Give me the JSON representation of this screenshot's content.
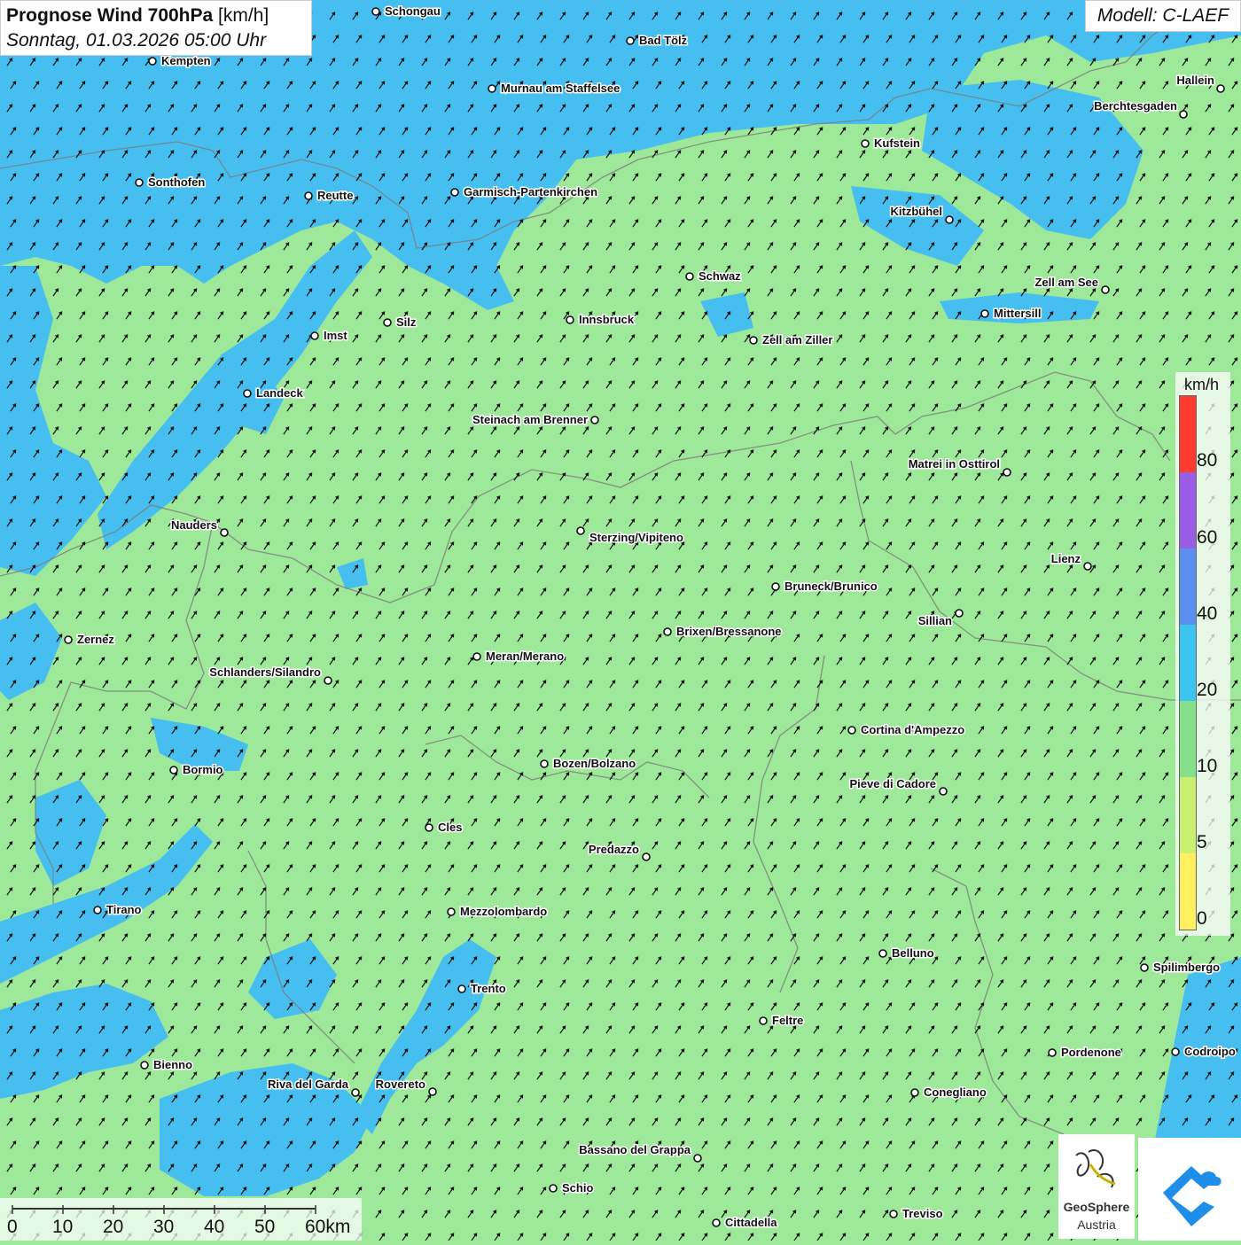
{
  "title": {
    "main": "Prognose Wind 700hPa",
    "unit": "[km/h]",
    "date": "Sonntag, 01.03.2026 05:00 Uhr"
  },
  "model": "Modell: C-LAEF",
  "legend": {
    "unit": "km/h",
    "labels": [
      "80",
      "60",
      "40",
      "20",
      "10",
      "5",
      "0"
    ],
    "colors": [
      "#ff3b30",
      "#9b5de5",
      "#5b8ff0",
      "#3cc4f0",
      "#86e08a",
      "#c9f06e",
      "#fff060"
    ]
  },
  "scale": {
    "labels": [
      "0",
      "10",
      "20",
      "30",
      "40",
      "50",
      "60km"
    ]
  },
  "branding": {
    "line1": "GeoSphere",
    "line2": "Austria"
  },
  "field_colors": {
    "green": "#9ee89a",
    "blue": "#46bff0"
  },
  "cities": [
    {
      "name": "Schongau"
    },
    {
      "name": "Bad Tölz"
    },
    {
      "name": "Kempten"
    },
    {
      "name": "Murnau am Staffelsee"
    },
    {
      "name": "Hallein"
    },
    {
      "name": "Berchtesgaden"
    },
    {
      "name": "Kufstein"
    },
    {
      "name": "Sonthofen"
    },
    {
      "name": "Reutte"
    },
    {
      "name": "Garmisch-Partenkirchen"
    },
    {
      "name": "Kitzbühel"
    },
    {
      "name": "Schwaz"
    },
    {
      "name": "Zell am See"
    },
    {
      "name": "Mittersill"
    },
    {
      "name": "Innsbruck"
    },
    {
      "name": "Silz"
    },
    {
      "name": "Imst"
    },
    {
      "name": "Zell am Ziller"
    },
    {
      "name": "Landeck"
    },
    {
      "name": "Steinach am Brenner"
    },
    {
      "name": "Matrei in Osttirol"
    },
    {
      "name": "Nauders"
    },
    {
      "name": "Sterzing/Vipiteno"
    },
    {
      "name": "Lienz"
    },
    {
      "name": "Bruneck/Brunico"
    },
    {
      "name": "Sillian"
    },
    {
      "name": "Zernez"
    },
    {
      "name": "Brixen/Bressanone"
    },
    {
      "name": "Meran/Merano"
    },
    {
      "name": "Schlanders/Silandro"
    },
    {
      "name": "Cortina d'Ampezzo"
    },
    {
      "name": "Bozen/Bolzano"
    },
    {
      "name": "Bormio"
    },
    {
      "name": "Pieve di Cadore"
    },
    {
      "name": "Cles"
    },
    {
      "name": "Predazzo"
    },
    {
      "name": "Tirano"
    },
    {
      "name": "Mezzolombardo"
    },
    {
      "name": "Belluno"
    },
    {
      "name": "Spilimbergo"
    },
    {
      "name": "Trento"
    },
    {
      "name": "Feltre"
    },
    {
      "name": "Pordenone"
    },
    {
      "name": "Codroipo"
    },
    {
      "name": "Bienno"
    },
    {
      "name": "Riva del Garda"
    },
    {
      "name": "Rovereto"
    },
    {
      "name": "Conegliano"
    },
    {
      "name": "Bassano del Grappa"
    },
    {
      "name": "Schio"
    },
    {
      "name": "Treviso"
    },
    {
      "name": "Cittadella"
    }
  ]
}
